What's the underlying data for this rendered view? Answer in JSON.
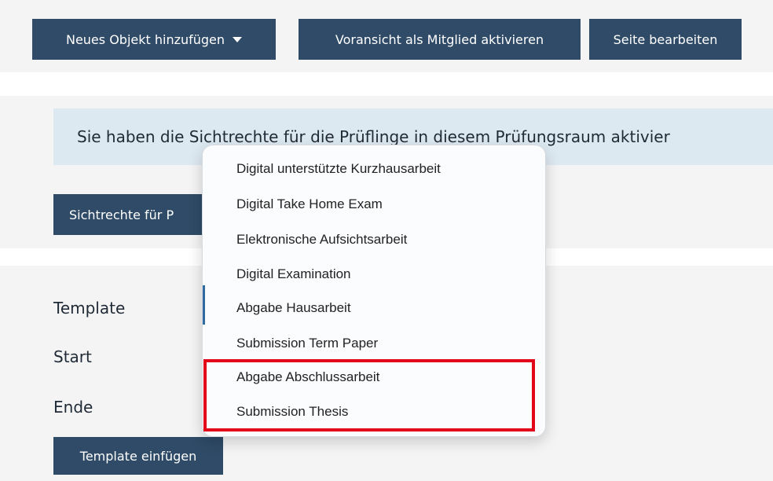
{
  "toolbar": {
    "add_object_label": "Neues Objekt hinzufügen",
    "preview_label": "Voransicht als Mitglied aktivieren",
    "edit_page_label": "Seite bearbeiten"
  },
  "info_message": "Sie haben die Sichtrechte für die Prüflinge in diesem Prüfungsraum aktivier",
  "visibility_button_label": "Sichtrechte für P",
  "form": {
    "template_label": "Template",
    "start_label": "Start",
    "end_label": "Ende",
    "insert_button_label": "Template einfügen"
  },
  "dropdown": {
    "items": [
      "Digital unterstützte Kurzhausarbeit",
      "Digital Take Home Exam",
      "Elektronische Aufsichtsarbeit",
      "Digital Examination",
      "Abgabe Hausarbeit",
      "Submission Term Paper",
      "Abgabe Abschlussarbeit",
      "Submission Thesis"
    ]
  },
  "colors": {
    "button_bg": "#2f4b67",
    "info_bg": "#dde9f1",
    "highlight_border": "#e3061b"
  }
}
